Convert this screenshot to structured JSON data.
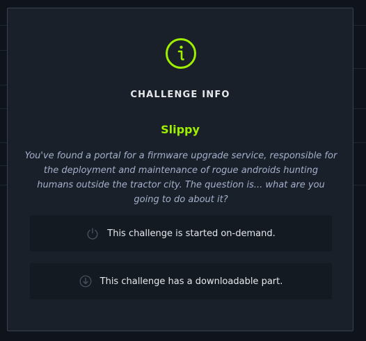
{
  "modal": {
    "icon": "info-circle-icon",
    "title": "CHALLENGE INFO",
    "challenge_name": "Slippy",
    "description": "You've found a portal for a firmware upgrade service, responsible for the deployment and maintenance of rogue androids hunting humans outside the tractor city. The question is... what are you going to do about it?",
    "features": [
      {
        "icon": "power-icon",
        "label": "This challenge is started on-demand."
      },
      {
        "icon": "download-icon",
        "label": "This challenge has a downloadable part."
      }
    ]
  },
  "colors": {
    "accent": "#9fef00",
    "modal_bg": "#1a2029",
    "feature_bg": "#141a22",
    "border": "#3a4150",
    "text": "#e6e8ec",
    "muted_text": "#a4b1cd"
  }
}
